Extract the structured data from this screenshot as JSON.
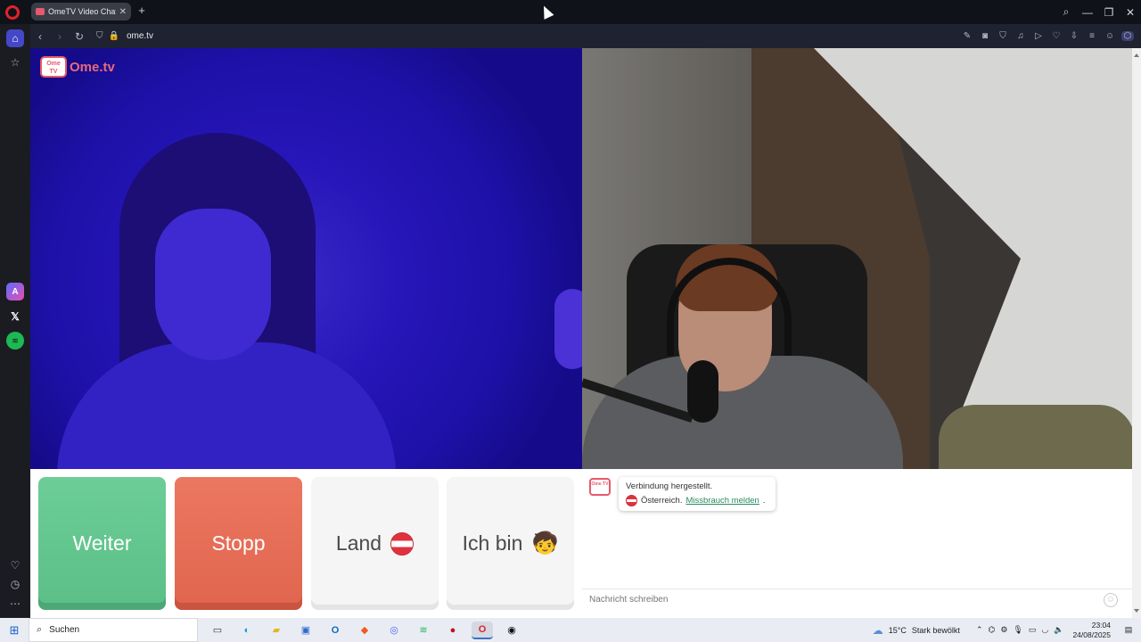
{
  "browser": {
    "tab_title": "OmeTV Video Chat -",
    "tab_close": "✕",
    "new_tab": "+",
    "url": "ome.tv",
    "window_controls": {
      "search": "⌕",
      "minimize": "—",
      "restore": "❐",
      "close": "✕"
    },
    "nav": {
      "back": "‹",
      "forward": "›",
      "reload": "↻"
    },
    "url_icons": {
      "shield": "⛉",
      "lock": "🔒"
    },
    "toolbar_icons": {
      "edit": "✎",
      "camera": "◙",
      "shield": "⛉",
      "music": "♫",
      "play": "▷",
      "heart": "♡",
      "download": "⇩",
      "menu": "≡",
      "profile": "☺",
      "extensions": "⬡"
    },
    "sidebar_icons": {
      "home": "⌂",
      "star": "☆",
      "aria": "A",
      "x": "𝕏",
      "spotify": "≋",
      "heart": "♡",
      "history": "◷",
      "more": "⋯"
    }
  },
  "omegle": {
    "logo_text": "Ome.tv",
    "logo_badge": "Ome TV",
    "buttons": {
      "next": "Weiter",
      "stop": "Stopp",
      "country": "Land",
      "i_am": "Ich bin",
      "i_am_emoji": "🧒"
    },
    "chat": {
      "status": "Verbindung hergestellt.",
      "country": "Österreich.",
      "report_link": "Missbrauch melden",
      "report_end": ".",
      "input_placeholder": "Nachricht schreiben",
      "emoji_icon": "☺"
    }
  },
  "taskbar": {
    "start_icon": "⊞",
    "search_icon": "⌕",
    "search_label": "Suchen",
    "apps": [
      "task-view",
      "edge",
      "explorer",
      "store",
      "outlook",
      "brave",
      "discord",
      "spotify",
      "app-red",
      "opera",
      "app-dark"
    ],
    "app_glyphs": {
      "task-view": "▭",
      "edge": "◐",
      "explorer": "▰",
      "store": "▣",
      "outlook": "O",
      "brave": "◆",
      "discord": "◎",
      "spotify": "≋",
      "app-red": "●",
      "opera": "O",
      "app-dark": "◉"
    },
    "weather_icon": "☁",
    "temperature": "15°C",
    "weather": "Stark bewölkt",
    "tray_icons": {
      "chevron": "⌃",
      "network_1": "⌬",
      "network_2": "⚙",
      "mic": "🎙",
      "monitor": "▭",
      "wifi": "◡",
      "volume": "🔈"
    },
    "time": "23:04",
    "date": "24/08/2025",
    "notification_icon": "▤"
  },
  "colors": {
    "next": "#5fc48b",
    "stop": "#e46a53",
    "brand": "#e8596b",
    "link": "#2b8a5e"
  }
}
